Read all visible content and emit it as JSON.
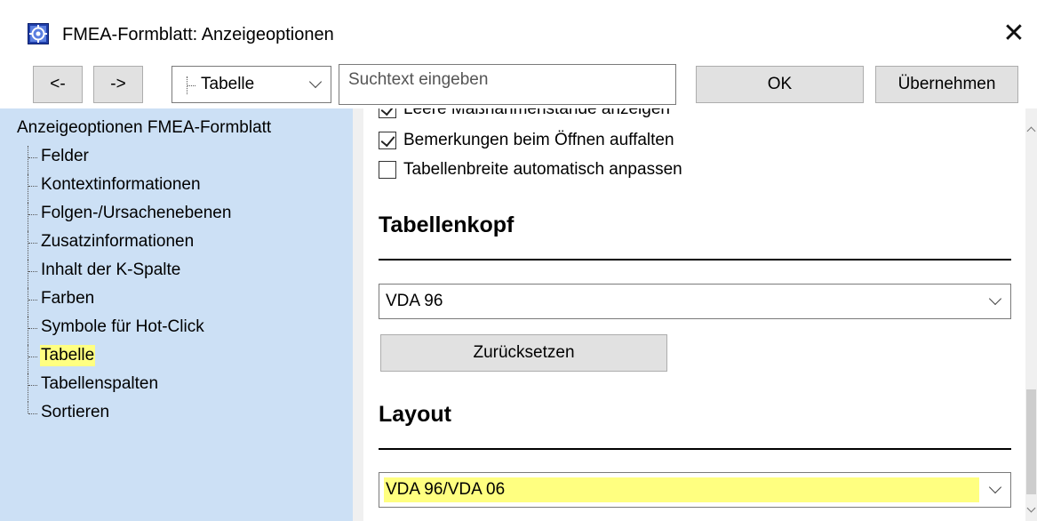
{
  "window": {
    "title": "FMEA-Formblatt: Anzeigeoptionen",
    "app_icon": "fmea-app-icon",
    "close_label": "✕"
  },
  "toolbar": {
    "back_label": "<-",
    "forward_label": "->",
    "tree_combo_value": "Tabelle",
    "search_placeholder": "Suchtext eingeben",
    "ok_label": "OK",
    "apply_label": "Übernehmen"
  },
  "sidebar": {
    "root_label": "Anzeigeoptionen FMEA-Formblatt",
    "items": [
      {
        "label": "Felder"
      },
      {
        "label": "Kontextinformationen"
      },
      {
        "label": "Folgen-/Ursachenebenen"
      },
      {
        "label": "Zusatzinformationen"
      },
      {
        "label": "Inhalt der K-Spalte"
      },
      {
        "label": "Farben"
      },
      {
        "label": "Symbole für Hot-Click"
      },
      {
        "label": "Tabelle",
        "selected": true
      },
      {
        "label": "Tabellenspalten"
      },
      {
        "label": "Sortieren"
      }
    ]
  },
  "content": {
    "checkbox_partial": {
      "label": "Leere Maßnahmenstände anzeigen",
      "checked": true
    },
    "checkbox_1": {
      "label": "Bemerkungen beim Öffnen auffalten",
      "checked": true
    },
    "checkbox_2": {
      "label": "Tabellenbreite automatisch anpassen",
      "checked": false
    },
    "header_section": {
      "title": "Tabellenkopf",
      "select_value": "VDA 96",
      "reset_label": "Zurücksetzen"
    },
    "layout_section": {
      "title": "Layout",
      "select_value": "VDA 96/VDA 06"
    }
  },
  "colors": {
    "sidebar_bg": "#cce0f5",
    "highlight": "#ffff80",
    "button_bg": "#e1e1e1"
  }
}
